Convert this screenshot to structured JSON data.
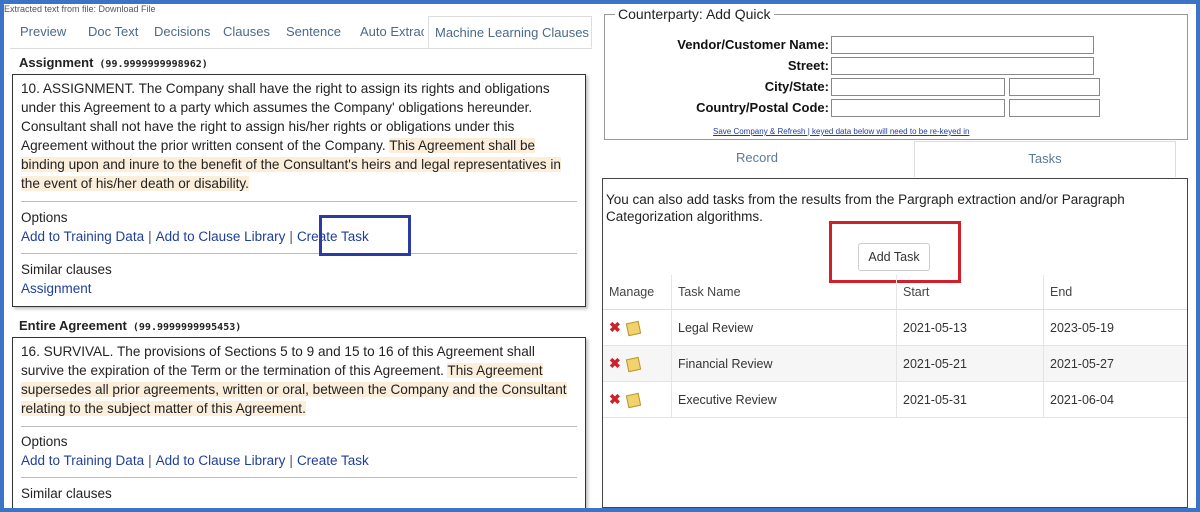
{
  "left": {
    "source_note": "Extracted text from file: Download File",
    "tabs": [
      "Preview",
      "Doc Text",
      "Decisions",
      "Clauses",
      "Sentence",
      "Auto Extrac",
      "Machine Learning Clauses"
    ],
    "clauses": [
      {
        "title": "Assignment",
        "score": "(99.9999999998962)",
        "text_plain": "10. ASSIGNMENT. The Company shall have the right to assign its rights and obligations under this Agreement to a party which assumes the Company' obligations hereunder. Consultant shall not have the right to assign his/her rights or obligations under this Agreement without the prior written consent of the Company. ",
        "text_highlight": "This Agreement shall be binding upon and inure to the benefit of the Consultant's heirs and legal representatives in the event of his/her death or disability.",
        "options_label": "Options",
        "links": [
          "Add to Training Data",
          "Add to Clause Library",
          "Create Task"
        ],
        "similar_label": "Similar clauses",
        "similar_link": "Assignment"
      },
      {
        "title": "Entire Agreement",
        "score": "(99.9999999995453)",
        "text_plain": "16. SURVIVAL. The provisions of Sections 5 to 9 and 15 to 16 of this Agreement shall survive the expiration of the Term or the termination of this Agreement. ",
        "text_highlight": "This Agreement supersedes all prior agreements, written or oral, between the Company and the Consultant relating to the subject matter of this Agreement.",
        "options_label": "Options",
        "links": [
          "Add to Training Data",
          "Add to Clause Library",
          "Create Task"
        ],
        "similar_label": "Similar clauses"
      }
    ],
    "separator": "|"
  },
  "right": {
    "counterparty": {
      "legend": "Counterparty: Add Quick",
      "vendor_label": "Vendor/Customer Name:",
      "street_label": "Street:",
      "city_label": "City/State:",
      "country_label": "Country/Postal Code:",
      "save_link": "Save Company & Refresh | keyed data below will need to be re-keyed in"
    },
    "tabs": [
      "Record",
      "Tasks"
    ],
    "tasks": {
      "intro": "You can also add tasks from the results from the Pargraph extraction and/or Paragraph Categorization algorithms.",
      "add_button": "Add Task",
      "columns": [
        "Manage",
        "Task Name",
        "Start",
        "End"
      ],
      "rows": [
        {
          "name": "Legal Review",
          "start": "2021-05-13",
          "end": "2023-05-19"
        },
        {
          "name": "Financial Review",
          "start": "2021-05-21",
          "end": "2021-05-27"
        },
        {
          "name": "Executive Review",
          "start": "2021-05-31",
          "end": "2021-06-04"
        }
      ]
    }
  },
  "colors": {
    "frame": "#3c73c4",
    "link": "#1f3f9a",
    "highlight": "#fbefdc",
    "annotation_blue": "#2b3ba6",
    "annotation_red": "#d0202a"
  }
}
